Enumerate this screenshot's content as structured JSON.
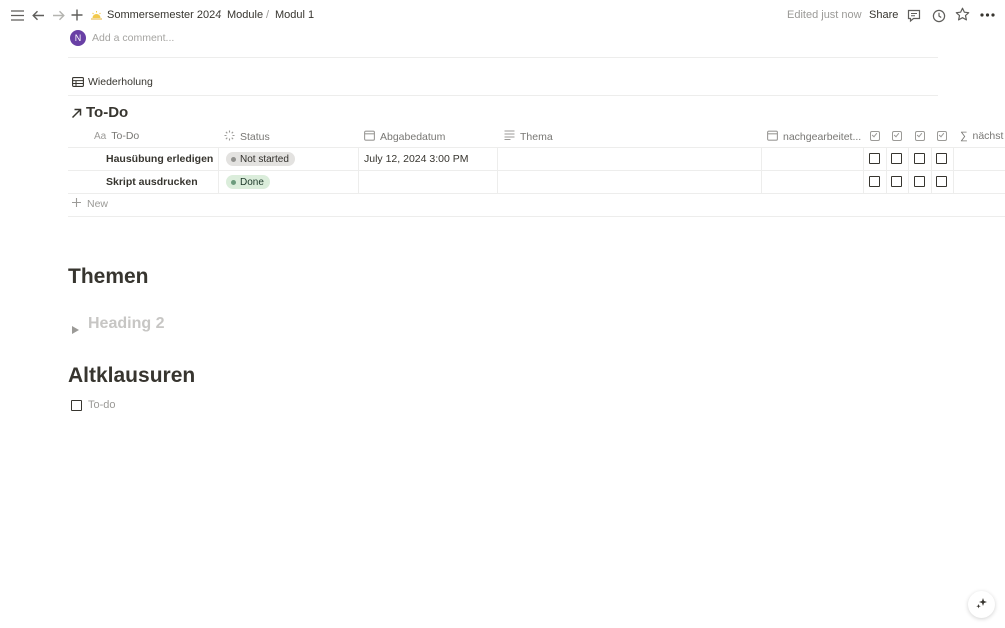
{
  "breadcrumb": {
    "items": [
      "Sommersemester 2024",
      "Module",
      "Modul 1"
    ],
    "separator": "/"
  },
  "topbar": {
    "edited": "Edited just now",
    "share": "Share"
  },
  "comment": {
    "avatar_initial": "N",
    "placeholder": "Add a comment..."
  },
  "linked_view": {
    "label": "Wiederholung"
  },
  "database": {
    "title": "To-Do",
    "columns": {
      "todo": "To-Do",
      "todo_icon": "Aa",
      "status": "Status",
      "due": "Abgabedatum",
      "topic": "Thema",
      "reviewed": "nachgearbeitet...",
      "next": "nächst",
      "next_icon": "∑"
    },
    "rows": [
      {
        "name": "Hausübung erledigen",
        "status": "Not started",
        "due": "July 12, 2024 3:00 PM",
        "topic": ""
      },
      {
        "name": "Skript ausdrucken",
        "status": "Done",
        "due": "",
        "topic": ""
      }
    ],
    "new_label": "New",
    "status_colors": {
      "not_started_bg": "#e3e2e0",
      "not_started_dot": "#91918e",
      "done_bg": "#dbeddb",
      "done_dot": "#6c9b7d",
      "done_text": "#1c3829"
    }
  },
  "sections": {
    "themen": "Themen",
    "toggle_heading": "Heading 2",
    "altklausuren": "Altklausuren",
    "todo_placeholder": "To-do"
  },
  "colors": {
    "avatar": "#6940a5"
  }
}
